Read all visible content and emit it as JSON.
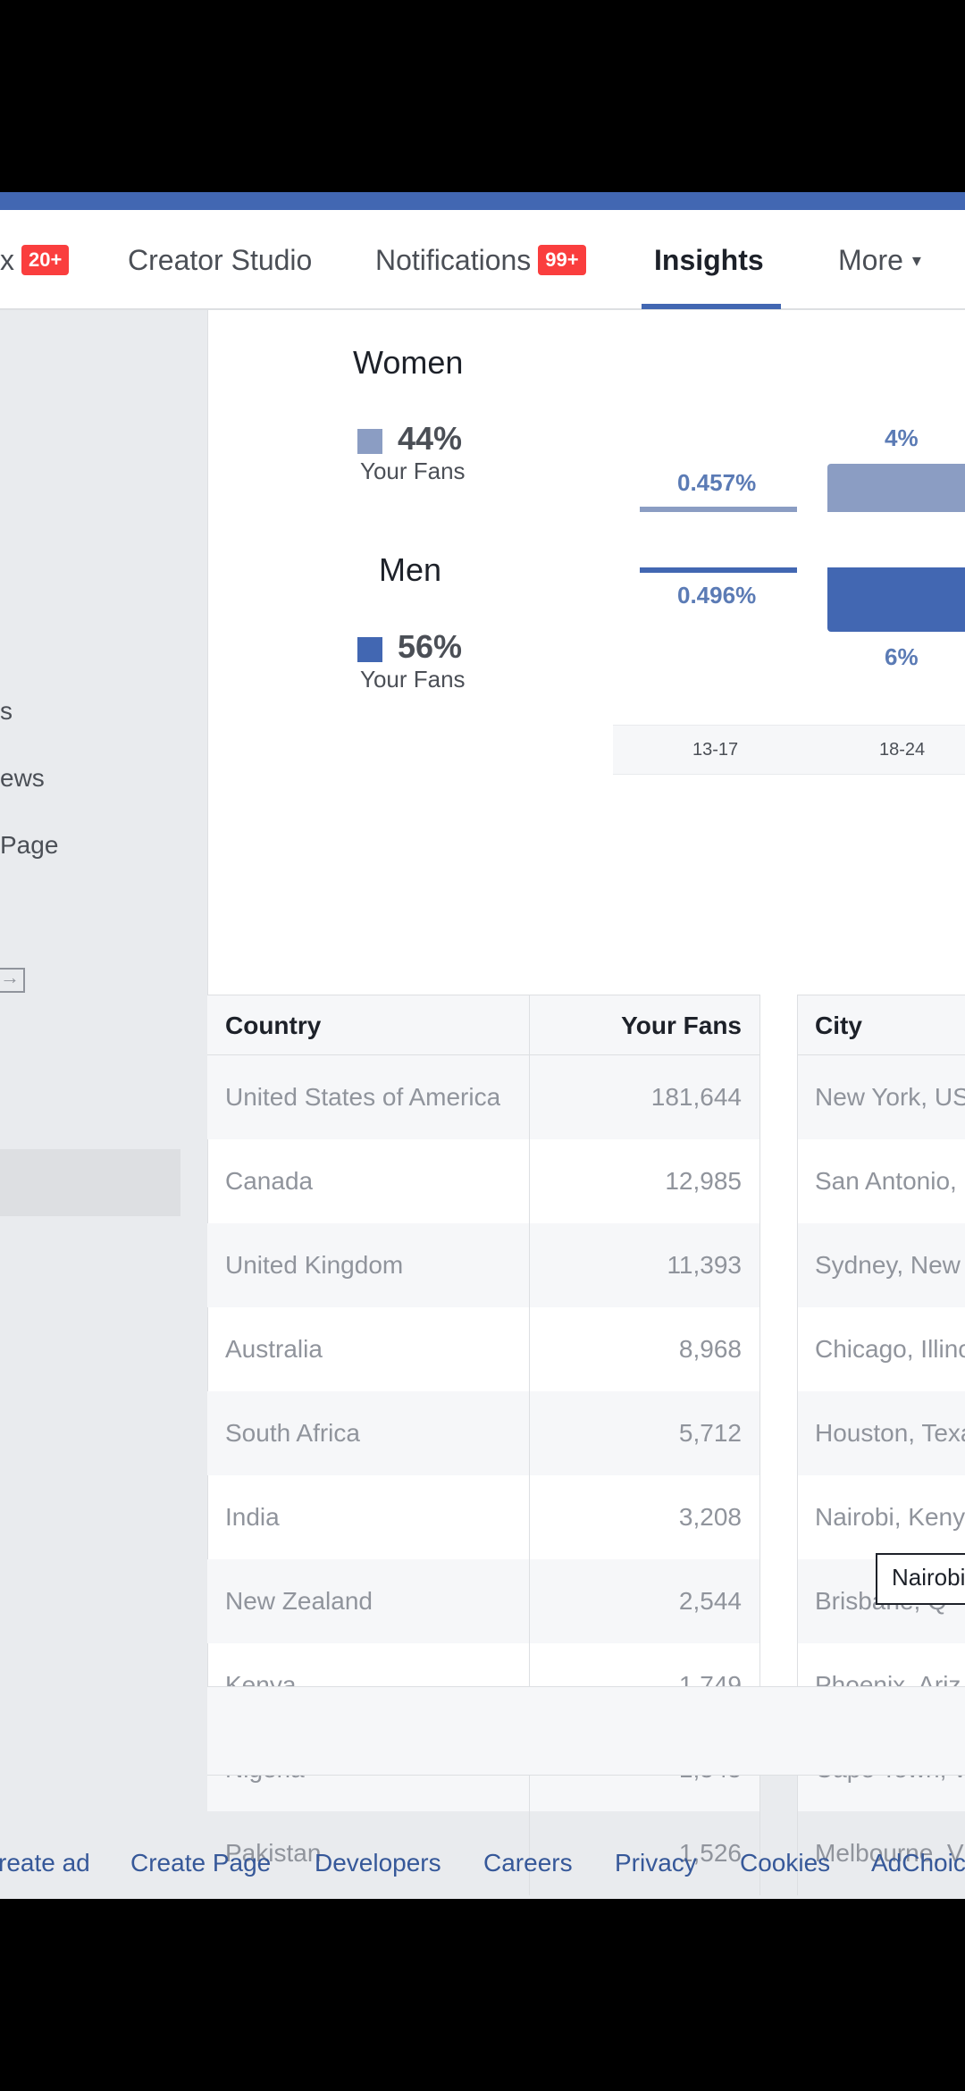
{
  "nav": {
    "inbox_badge": "20+",
    "tabs": [
      {
        "label": "Creator Studio"
      },
      {
        "label": "Notifications",
        "badge": "99+"
      },
      {
        "label": "Insights"
      },
      {
        "label": "More"
      }
    ],
    "active_tab": "Insights",
    "inbox_partial": "x"
  },
  "sidebar": {
    "items": [
      "s",
      "ews",
      "Page"
    ]
  },
  "gender": {
    "women": {
      "title": "Women",
      "pct": "44%",
      "sub": "Your Fans",
      "color": "#8b9dc3"
    },
    "men": {
      "title": "Men",
      "pct": "56%",
      "sub": "Your Fans",
      "color": "#4267b2"
    }
  },
  "age_chart": {
    "categories": [
      "13-17",
      "18-24"
    ],
    "women": [
      "0.457%",
      "4%"
    ],
    "men": [
      "0.496%",
      "6%"
    ]
  },
  "country_table": {
    "headers": [
      "Country",
      "Your Fans"
    ],
    "rows": [
      [
        "United States of America",
        "181,644"
      ],
      [
        "Canada",
        "12,985"
      ],
      [
        "United Kingdom",
        "11,393"
      ],
      [
        "Australia",
        "8,968"
      ],
      [
        "South Africa",
        "5,712"
      ],
      [
        "India",
        "3,208"
      ],
      [
        "New Zealand",
        "2,544"
      ],
      [
        "Kenya",
        "1,749"
      ],
      [
        "Nigeria",
        "1,545"
      ],
      [
        "Pakistan",
        "1,526"
      ]
    ]
  },
  "city_table": {
    "header": "City",
    "rows": [
      "New York, US",
      "San Antonio,",
      "Sydney, New",
      "Chicago, Illino",
      "Houston, Texa",
      "Nairobi, Keny",
      "Brisbane, Q",
      "Phoenix, Ariz",
      "Cape Town, W",
      "Melbourne, V"
    ]
  },
  "tooltip": "Nairobi",
  "footer": {
    "links": [
      "reate ad",
      "Create Page",
      "Developers",
      "Careers",
      "Privacy",
      "Cookies",
      "AdChoic"
    ]
  }
}
